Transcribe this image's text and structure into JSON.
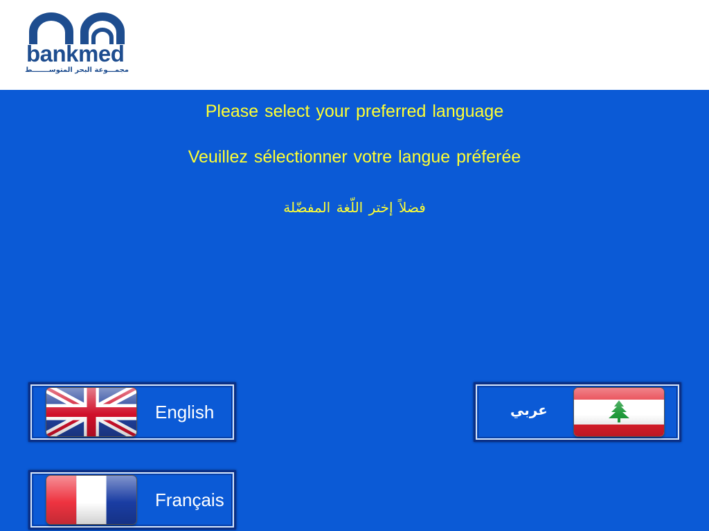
{
  "header": {
    "logo": {
      "wordmark": "bankmed",
      "superscript": "ـ",
      "tagline": "مجمـــوعة البحر المتوســـــــط",
      "color": "#1e4d8f"
    }
  },
  "prompts": {
    "english": "Please select your preferred language",
    "french": "Veuillez sélectionner votre langue préferée",
    "arabic": "فضلاً إختر اللّغة المفضّلة"
  },
  "languages": {
    "english": {
      "label": "English",
      "flag": "uk-flag-icon"
    },
    "french": {
      "label": "Français",
      "flag": "france-flag-icon"
    },
    "arabic": {
      "label": "عربي",
      "flag": "lebanon-flag-icon"
    }
  },
  "colors": {
    "background": "#0b5ad6",
    "prompt_text": "#ffff33",
    "button_text": "#ffffff"
  }
}
